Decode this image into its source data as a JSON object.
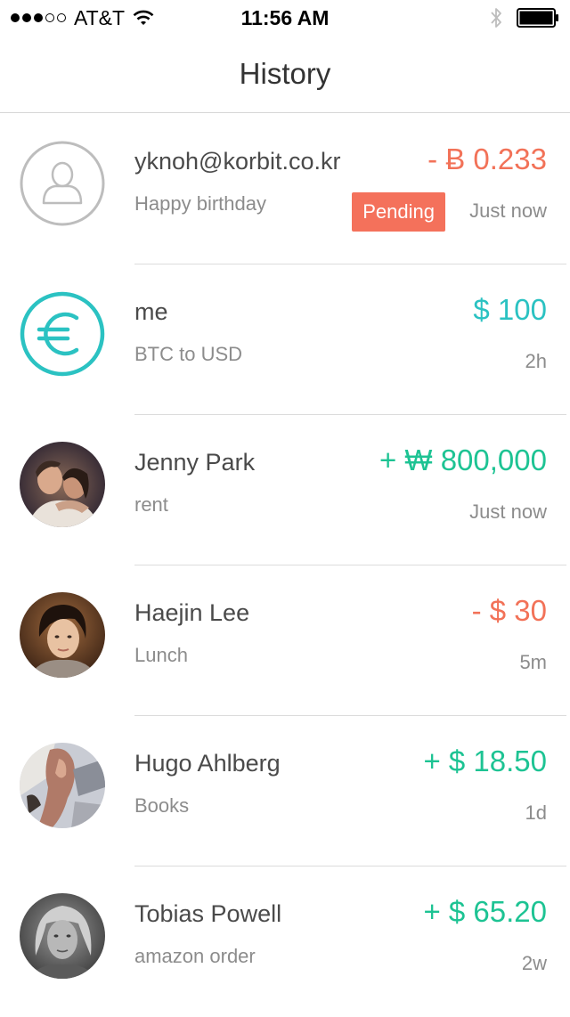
{
  "status_bar": {
    "carrier": "AT&T",
    "time": "11:56 AM",
    "signal_dots_filled": 3,
    "signal_dots_total": 5,
    "icons": [
      "wifi-icon",
      "bluetooth-icon",
      "battery-icon"
    ]
  },
  "nav": {
    "title": "History"
  },
  "colors": {
    "negative": "#f27258",
    "positive": "#1dc393",
    "neutral": "#2bc2c2",
    "badge": "#f4715b"
  },
  "transactions": [
    {
      "name": "yknoh@korbit.co.kr",
      "note": "Happy birthday",
      "amount": "- Ƀ 0.233",
      "time": "Just now",
      "badge": "Pending",
      "avatar": "user-placeholder-icon"
    },
    {
      "name": "me",
      "note": "BTC to USD",
      "amount": "$ 100",
      "time": "2h",
      "avatar": "euro-icon"
    },
    {
      "name": "Jenny Park",
      "note": "rent",
      "amount": "+ ₩ 800,000",
      "time": "Just now",
      "avatar": "photo"
    },
    {
      "name": "Haejin Lee",
      "note": "Lunch",
      "amount": "- $ 30",
      "time": "5m",
      "avatar": "photo"
    },
    {
      "name": "Hugo Ahlberg",
      "note": "Books",
      "amount": "+ $ 18.50",
      "time": "1d",
      "avatar": "photo"
    },
    {
      "name": "Tobias Powell",
      "note": "amazon order",
      "amount": "+ $ 65.20",
      "time": "2w",
      "avatar": "photo"
    }
  ]
}
